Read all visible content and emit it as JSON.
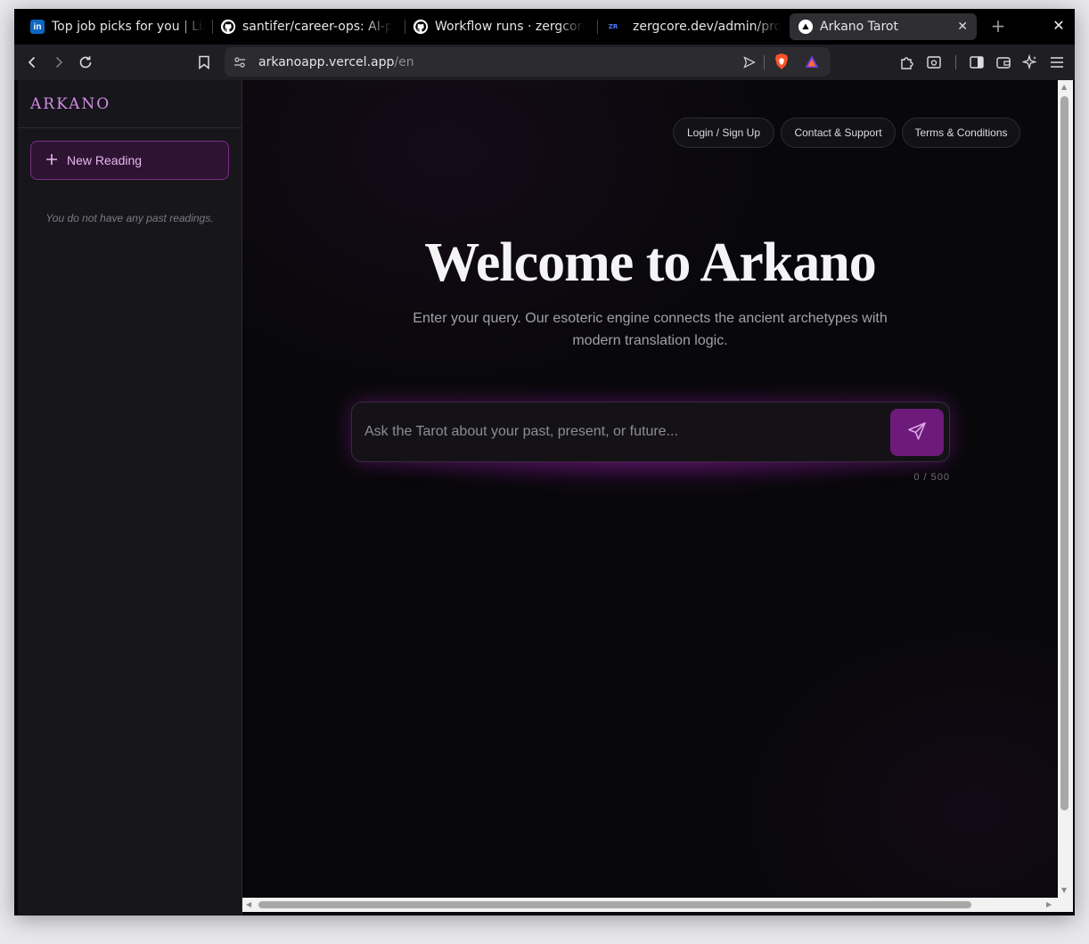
{
  "browser": {
    "tabs": [
      {
        "title": "Top job picks for you | Lin",
        "icon": "linkedin-icon"
      },
      {
        "title": "santifer/career-ops: AI-p",
        "icon": "github-icon"
      },
      {
        "title": "Workflow runs · zergcore",
        "icon": "github-icon"
      },
      {
        "title": "zergcore.dev/admin/proj",
        "icon": "zergcore-icon"
      },
      {
        "title": "Arkano Tarot",
        "icon": "triangle-icon"
      }
    ],
    "new_tab": "+",
    "window_close": "✕",
    "tab_close": "✕",
    "favicon_linkedin": "in",
    "favicon_zergcore": "ZR",
    "url_host": "arkanoapp.vercel.app",
    "url_path": "/en"
  },
  "sidebar": {
    "logo": "ARKANO",
    "new_reading_label": "New Reading",
    "empty_text": "You do not have any past readings."
  },
  "nav": {
    "login": "Login / Sign Up",
    "contact": "Contact & Support",
    "terms": "Terms & Conditions"
  },
  "hero": {
    "title": "Welcome to Arkano",
    "subtitle": "Enter your query. Our esoteric engine connects the ancient archetypes with modern translation logic."
  },
  "query": {
    "placeholder": "Ask the Tarot about your past, present, or future...",
    "value": "",
    "counter": "0 / 500"
  },
  "colors": {
    "accent": "#6d1a7a",
    "logo": "#d68be8",
    "sidebar_bg": "#16161b",
    "main_bg": "#08080a"
  }
}
